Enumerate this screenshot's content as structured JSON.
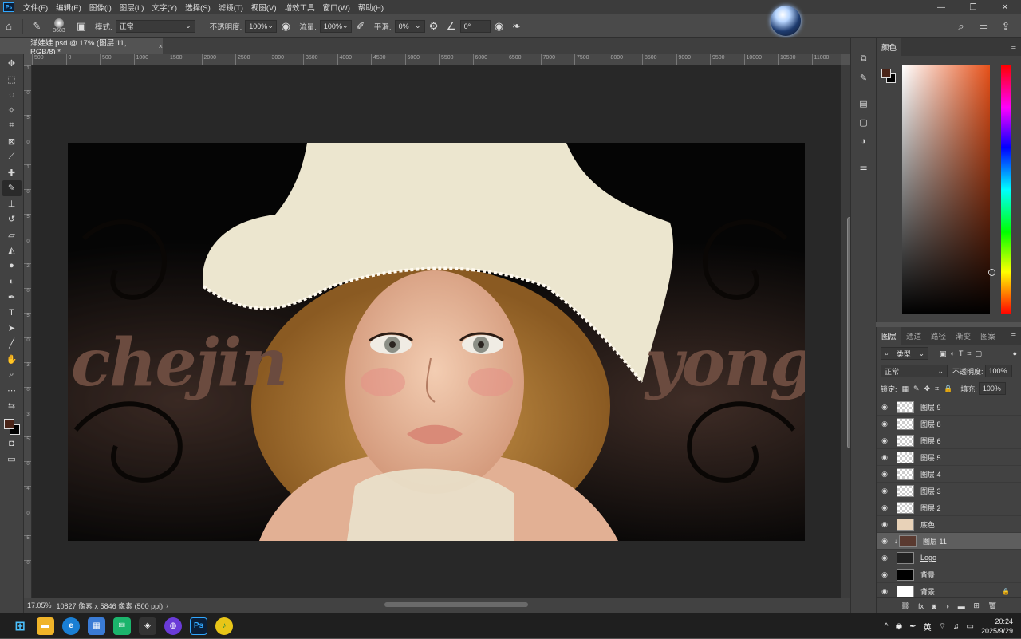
{
  "menu": {
    "app_badge": "Ps",
    "items": [
      "文件(F)",
      "编辑(E)",
      "图像(I)",
      "图层(L)",
      "文字(Y)",
      "选择(S)",
      "滤镜(T)",
      "视图(V)",
      "增效工具",
      "窗口(W)",
      "帮助(H)"
    ]
  },
  "window_controls": {
    "minimize": "—",
    "restore": "❐",
    "close": "✕"
  },
  "options": {
    "brush_size": "3683",
    "mode_label": "模式:",
    "mode_value": "正常",
    "opacity_label": "不透明度:",
    "opacity_value": "100%",
    "flow_label": "流量:",
    "flow_value": "100%",
    "smoothing_label": "平滑:",
    "smoothing_value": "0%",
    "angle_value": "0°"
  },
  "document": {
    "tab_title": "洋娃娃.psd @ 17% (图层 11, RGB/8) *",
    "close": "×"
  },
  "ruler": {
    "h_ticks": [
      "500",
      "0",
      "500",
      "1000",
      "1500",
      "2000",
      "2500",
      "3000",
      "3500",
      "4000",
      "4500",
      "5000",
      "5500",
      "6000",
      "6500",
      "7000",
      "7500",
      "8000",
      "8500",
      "9000",
      "9500",
      "10000",
      "10500",
      "11000"
    ],
    "v_ticks": [
      "1",
      "0",
      "5",
      "0",
      "1",
      "0",
      "5",
      "0",
      "2",
      "0",
      "5",
      "0",
      "3",
      "0",
      "3",
      "5",
      "0",
      "4",
      "0",
      "5",
      "0"
    ]
  },
  "artwork": {
    "left_word": "chejin",
    "right_word": "yong"
  },
  "status": {
    "zoom": "17.05%",
    "dimensions": "10827 像素 x 5846 像素 (500 ppi)",
    "arrow": "›"
  },
  "color_panel": {
    "tab": "颜色",
    "fg_color": "#4a2418",
    "bg_color": "#000000"
  },
  "layers_panel": {
    "tabs": [
      "图层",
      "通道",
      "路径",
      "渐变",
      "图案"
    ],
    "filter_label": "类型",
    "blend_mode": "正常",
    "opacity_label": "不透明度:",
    "opacity_value": "100%",
    "lock_label": "锁定:",
    "fill_label": "填充:",
    "fill_value": "100%",
    "layers": [
      {
        "name": "图层 9"
      },
      {
        "name": "图层 8"
      },
      {
        "name": "图层 6"
      },
      {
        "name": "图层 5"
      },
      {
        "name": "图层 4"
      },
      {
        "name": "图层 3"
      },
      {
        "name": "图层 2"
      },
      {
        "name": "底色"
      },
      {
        "name": "图层 11",
        "selected": true
      },
      {
        "name": "Logo"
      },
      {
        "name": "背景"
      },
      {
        "name": "背景",
        "locked": true
      }
    ]
  },
  "taskbar": {
    "ime": "英",
    "time": "20:24",
    "date": "2025/9/29"
  }
}
